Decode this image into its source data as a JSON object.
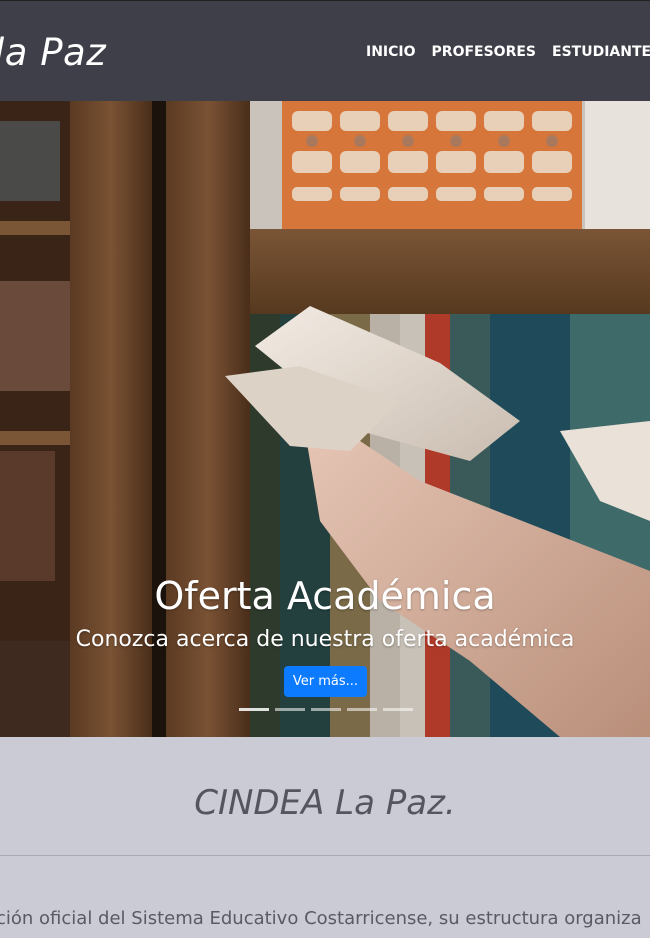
{
  "navbar": {
    "brand": "la Paz",
    "links": [
      {
        "label": "INICIO"
      },
      {
        "label": "PROFESORES"
      },
      {
        "label": "ESTUDIANTES"
      }
    ]
  },
  "carousel": {
    "title": "Oferta Académica",
    "subtitle": "Conozca acerca de nuestra oferta académica",
    "button_label": "Ver más...",
    "slide_count": 5,
    "active_slide": 1
  },
  "content": {
    "heading": "CINDEA La Paz.",
    "paragraph": "ción oficial del Sistema Educativo Costarricense, su estructura organiza"
  },
  "colors": {
    "navbar_bg": "#3f3f4a",
    "page_bg": "#cacbd4",
    "button_bg": "#0d7bff",
    "text_gray": "#55555f"
  }
}
